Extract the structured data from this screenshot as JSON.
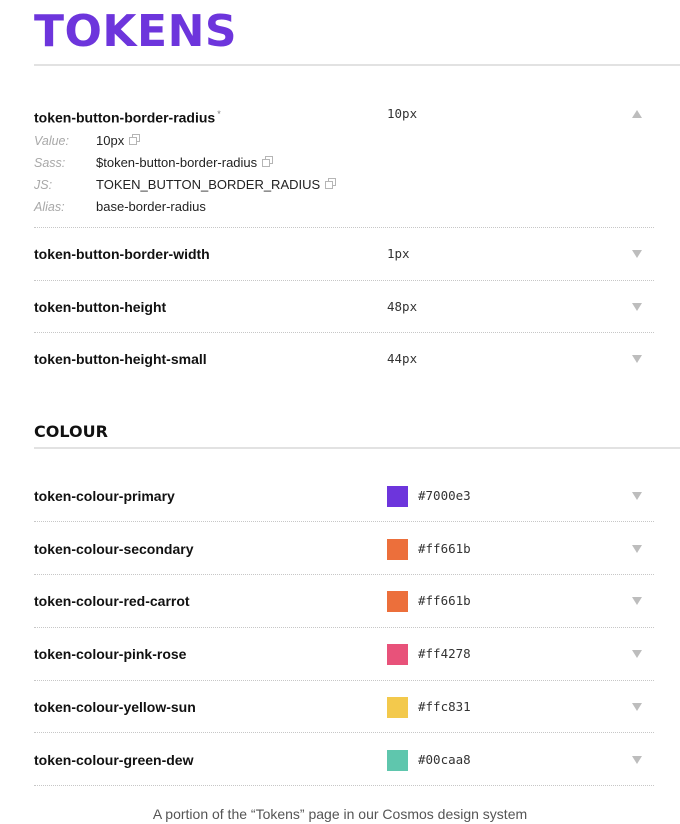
{
  "page": {
    "title": "TOKENS",
    "caption": "A portion of the “Tokens” page in our Cosmos design system"
  },
  "button_tokens": [
    {
      "name": "token-button-border-radius",
      "marker": "*",
      "value": "10px",
      "expanded": true,
      "details": {
        "value_label": "Value:",
        "value": "10px",
        "sass_label": "Sass:",
        "sass": "$token-button-border-radius",
        "js_label": "JS:",
        "js": "TOKEN_BUTTON_BORDER_RADIUS",
        "alias_label": "Alias:",
        "alias": "base-border-radius"
      }
    },
    {
      "name": "token-button-border-width",
      "value": "1px",
      "expanded": false
    },
    {
      "name": "token-button-height",
      "value": "48px",
      "expanded": false
    },
    {
      "name": "token-button-height-small",
      "value": "44px",
      "expanded": false
    }
  ],
  "colour_section": {
    "title": "COLOUR",
    "tokens": [
      {
        "name": "token-colour-primary",
        "value": "#7000e3",
        "swatch": "#6d35dc"
      },
      {
        "name": "token-colour-secondary",
        "value": "#ff661b",
        "swatch": "#ec6f3b"
      },
      {
        "name": "token-colour-red-carrot",
        "value": "#ff661b",
        "swatch": "#ec6f3b"
      },
      {
        "name": "token-colour-pink-rose",
        "value": "#ff4278",
        "swatch": "#e8527a"
      },
      {
        "name": "token-colour-yellow-sun",
        "value": "#ffc831",
        "swatch": "#f3c94c"
      },
      {
        "name": "token-colour-green-dew",
        "value": "#00caa8",
        "swatch": "#5fc6ad"
      }
    ]
  },
  "icons": {
    "expand": "chevron-down-icon",
    "collapse": "chevron-up-icon",
    "copy": "copy-icon"
  },
  "colors": {
    "accent": "#6d35dc",
    "divider": "#e2e2e2"
  }
}
